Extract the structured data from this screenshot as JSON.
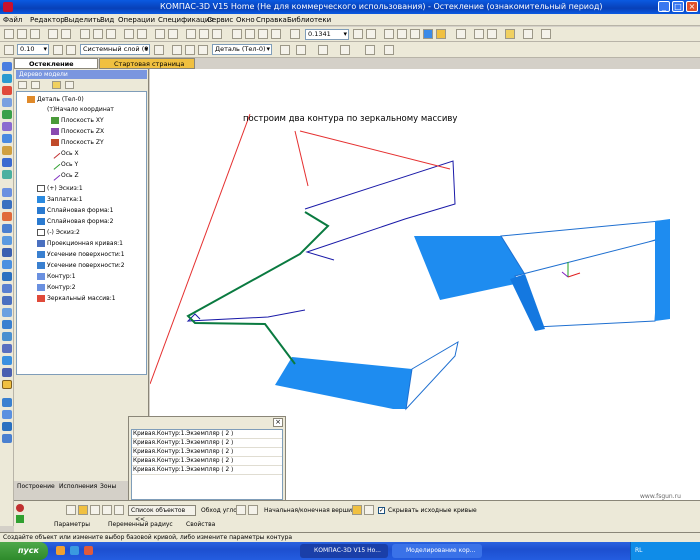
{
  "window": {
    "title": "КОМПАС-3D V15 Home (Не для коммерческого использования) - Остекление (ознакомительный период)"
  },
  "menu": [
    "Файл",
    "Редактор",
    "Выделить",
    "Вид",
    "Операции",
    "Спецификация",
    "Сервис",
    "Окно",
    "Справка",
    "Библиотеки"
  ],
  "toolbar": {
    "line_width": "0.10",
    "layer": "Системный слой (0)",
    "scale": "0.1341",
    "detail": "Деталь (Тел-0)"
  },
  "tabs": [
    "Остекление",
    "Стартовая страница"
  ],
  "tree": {
    "header": "Дерево модели",
    "items": [
      "Деталь (Тел-0)",
      "(т)Начало координат",
      "Плоскость XY",
      "Плоскость ZX",
      "Плоскость ZY",
      "Ось X",
      "Ось Y",
      "Ось Z",
      "(+) Эскиз:1",
      "Заплатка:1",
      "Сплайновая форма:1",
      "Сплайновая форма:2",
      "(-) Эскиз:2",
      "Проекционная кривая:1",
      "Усечение поверхности:1",
      "Усечение поверхности:2",
      "Контур:1",
      "Контур:2",
      "Зеркальный массив:1"
    ]
  },
  "annotation": "построим два контура по зеркальному массиву",
  "objects_list": {
    "rows": [
      "Кривая.Контур:1.Экземпляр ( 2 )",
      "Кривая.Контур:1.Экземпляр ( 2 )",
      "Кривая.Контур:1.Экземпляр ( 2 )",
      "Кривая.Контур:1.Экземпляр ( 2 )",
      "Кривая.Контур:1.Экземпляр ( 2 )"
    ]
  },
  "bottom_tabs": [
    "Построение",
    "Исполнения",
    "Зоны"
  ],
  "props": {
    "objects_list_btn": "Список объектов",
    "objects_list_arrows": "<<",
    "bypass_label": "Обход углов",
    "vertex_label": "Начальная/конечная вершина",
    "hide_curves_label": "Скрывать исходные кривые",
    "tab_params": "Параметры",
    "tab_var_radius": "Переменный радиус",
    "tab_props": "Свойства"
  },
  "status_text": "Создайте объект или измените выбор базовой кривой, либо измените параметры контура",
  "watermark": "www.fsgun.ru",
  "taskbar": {
    "start": "пуск",
    "tasks": [
      "КОМПАС-3D V15 Ho...",
      "Моделирование кор..."
    ],
    "lang": "RL"
  },
  "colors": {
    "titlebar": "#0a5ae2",
    "surface": "#1e8cf0",
    "annotation_line": "#e53030",
    "curve": "#1a1aa8"
  }
}
